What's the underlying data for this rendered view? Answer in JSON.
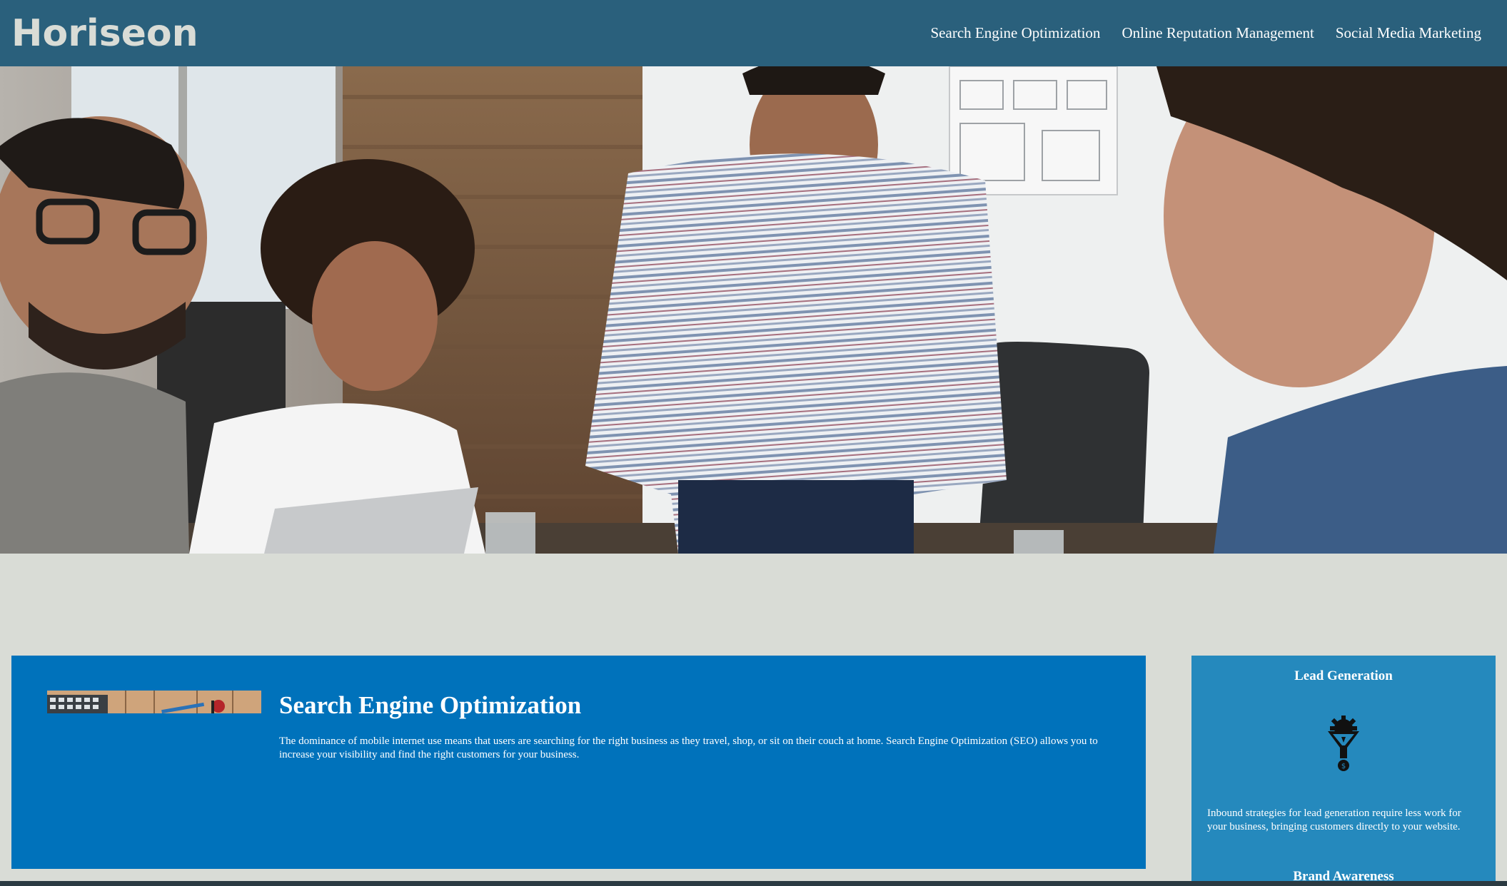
{
  "header": {
    "logo": "Horiseon",
    "nav": [
      "Search Engine Optimization",
      "Online Reputation Management",
      "Social Media Marketing"
    ]
  },
  "hero": {
    "icon": "team-meeting-photo"
  },
  "content": {
    "title": "Search Engine Optimization",
    "text": "The dominance of mobile internet use means that users are searching for the right business as they travel, shop, or sit on their couch at home. Search Engine Optimization (SEO) allows you to increase your visibility and find the right customers for your business.",
    "thumb_icon": "seo-thumbnail"
  },
  "benefits": {
    "lead_title": "Lead Generation",
    "lead_icon": "lead-generation-funnel-icon",
    "lead_text": "Inbound strategies for lead generation require less work for your business, bringing customers directly to your website.",
    "brand_title": "Brand Awareness"
  },
  "colors": {
    "header_bg": "#2a607c",
    "page_bg": "#d9dcd6",
    "card_bg": "#0072bb",
    "benefits_bg": "#2589bd"
  }
}
